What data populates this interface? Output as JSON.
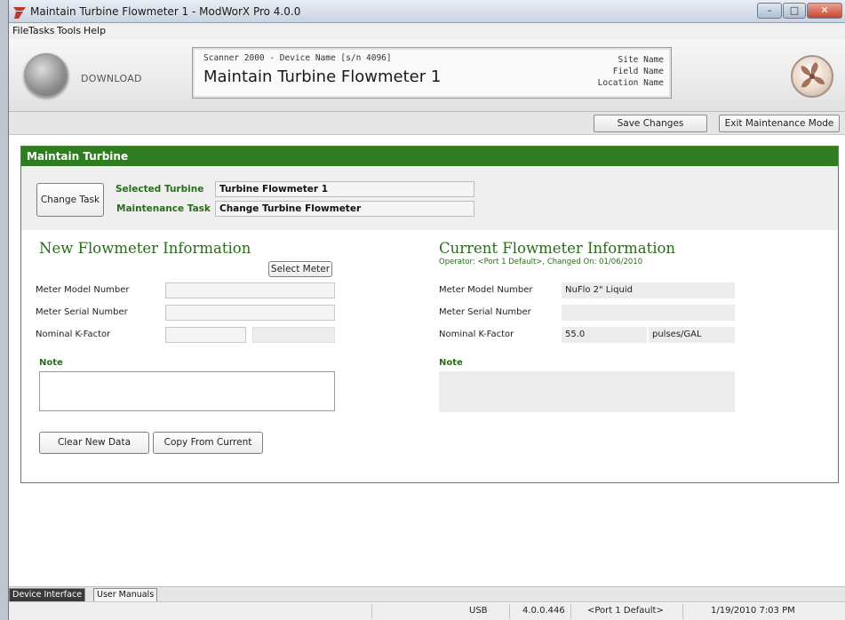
{
  "window": {
    "title": "Maintain Turbine Flowmeter 1 - ModWorX Pro 4.0.0"
  },
  "menu": [
    "File",
    "Tasks",
    "Tools",
    "Help"
  ],
  "toolbar": {
    "download_label": "DOWNLOAD",
    "device_line": "Scanner 2000 - Device Name [s/n 4096]",
    "device_title": "Maintain Turbine Flowmeter 1",
    "site_name": "Site Name",
    "field_name": "Field Name",
    "location_name": "Location Name"
  },
  "actions": {
    "save": "Save Changes",
    "exit": "Exit Maintenance Mode"
  },
  "panel": {
    "header": "Maintain Turbine",
    "change_task": "Change Task",
    "selected_turbine_label": "Selected Turbine",
    "selected_turbine_value": "Turbine Flowmeter 1",
    "maintenance_task_label": "Maintenance Task",
    "maintenance_task_value": "Change Turbine Flowmeter"
  },
  "new_info": {
    "title": "New Flowmeter Information",
    "select_meter": "Select Meter",
    "model_label": "Meter Model Number",
    "serial_label": "Meter Serial Number",
    "kfactor_label": "Nominal K-Factor",
    "note_label": "Note",
    "clear_btn": "Clear New Data",
    "copy_btn": "Copy From Current"
  },
  "current_info": {
    "title": "Current Flowmeter Information",
    "subtitle": "Operator: <Port 1 Default>, Changed On: 01/06/2010",
    "model_label": "Meter Model Number",
    "model_value": "NuFlo 2\" Liquid",
    "serial_label": "Meter Serial Number",
    "serial_value": "",
    "kfactor_label": "Nominal K-Factor",
    "kfactor_value": "55.0",
    "kfactor_unit": "pulses/GAL",
    "note_label": "Note"
  },
  "tabs": [
    "Device Interface",
    "User Manuals"
  ],
  "status": {
    "conn": "USB",
    "version": "4.0.0.446",
    "port": "<Port 1 Default>",
    "datetime": "1/19/2010 7:03 PM"
  },
  "colors": {
    "accent_green": "#2f7d20",
    "label_green": "#2a6b1d"
  }
}
